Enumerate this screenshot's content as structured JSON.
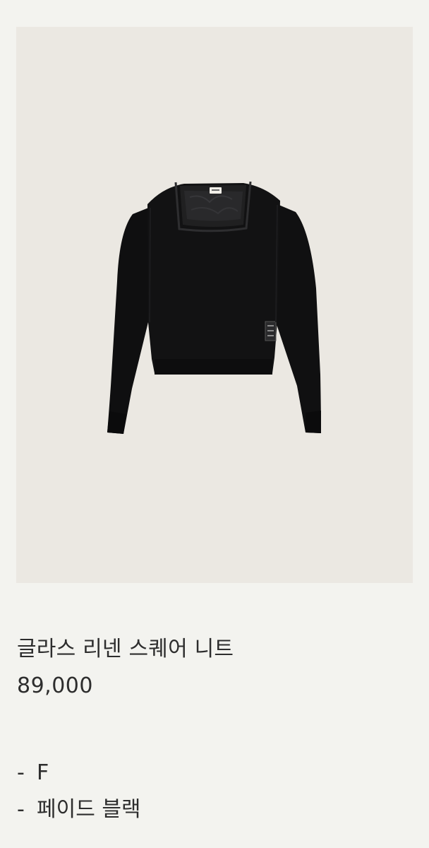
{
  "product": {
    "name": "글라스 리넨 스퀘어 니트",
    "price": "89,000",
    "image_alt": "black square-neck knit sweater",
    "options": [
      {
        "dash": "-",
        "text": "F"
      },
      {
        "dash": "-",
        "text": "페이드 블랙"
      }
    ],
    "colors": {
      "page_background": "#f3f3ef",
      "image_background": "#ebe8e2",
      "garment": "#111111"
    }
  }
}
